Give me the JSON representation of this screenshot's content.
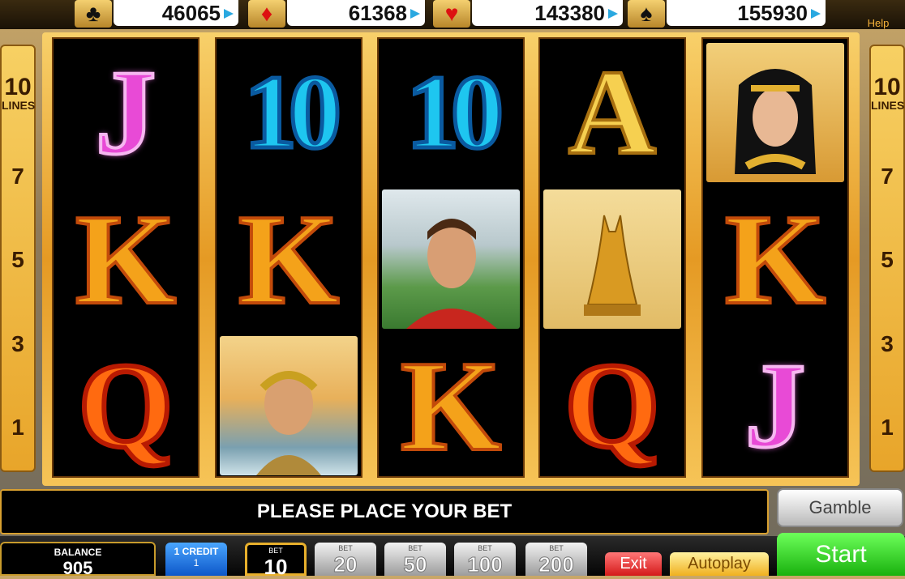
{
  "jackpots": [
    {
      "suit_icon": "club-icon",
      "glyph": "♣",
      "value": "46065"
    },
    {
      "suit_icon": "diamond-icon",
      "glyph": "♦",
      "value": "61368"
    },
    {
      "suit_icon": "heart-icon",
      "glyph": "♥",
      "value": "143380"
    },
    {
      "suit_icon": "spade-icon",
      "glyph": "♠",
      "value": "155930"
    }
  ],
  "help_label": "Help",
  "lines": {
    "count": "10",
    "label": "LINES",
    "markers": [
      "7",
      "5",
      "3",
      "1"
    ]
  },
  "reels": [
    [
      "J",
      "K",
      "Q"
    ],
    [
      "10",
      "K",
      "Caesar"
    ],
    [
      "10",
      "Roman warrior",
      "K"
    ],
    [
      "A",
      "Cat statue",
      "Q"
    ],
    [
      "Cleopatra",
      "K",
      "J"
    ]
  ],
  "message": "PLEASE PLACE YOUR BET",
  "gamble_label": "Gamble",
  "balance": {
    "label": "BALANCE",
    "value": "905"
  },
  "credit": {
    "label": "1 CREDIT",
    "value": "1"
  },
  "bets": [
    {
      "label": "BET",
      "value": "10",
      "selected": true
    },
    {
      "label": "BET",
      "value": "20",
      "selected": false
    },
    {
      "label": "BET",
      "value": "50",
      "selected": false
    },
    {
      "label": "BET",
      "value": "100",
      "selected": false
    },
    {
      "label": "BET",
      "value": "200",
      "selected": false
    }
  ],
  "exit_label": "Exit",
  "autoplay_label": "Autoplay",
  "start_label": "Start",
  "colors": {
    "accent_gold": "#e59a24",
    "start_green": "#19b10e",
    "credit_blue": "#0d57c9",
    "exit_red": "#d41a1a"
  }
}
